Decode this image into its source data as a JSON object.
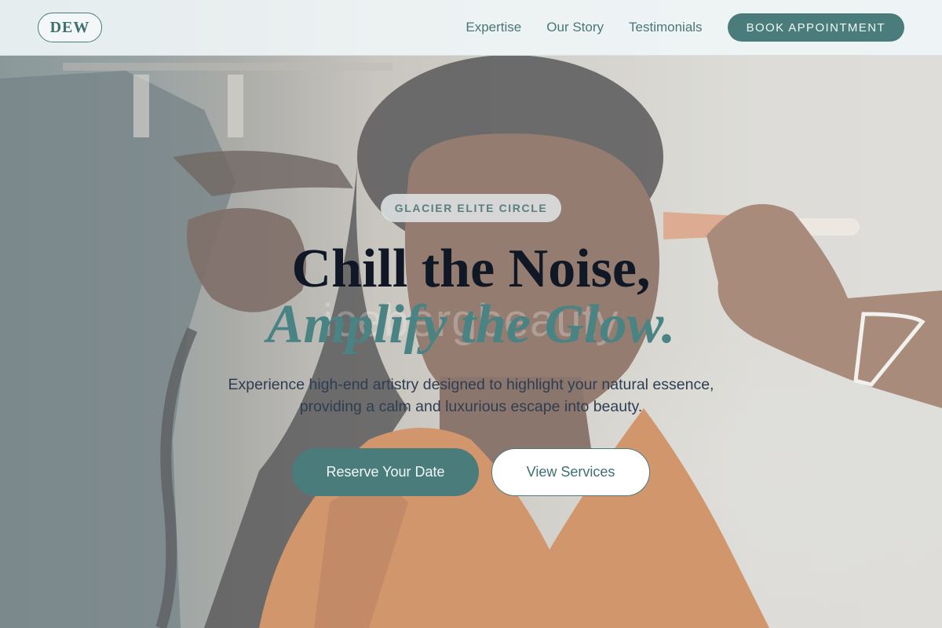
{
  "brand": {
    "logo_text": "DEW"
  },
  "nav": {
    "links": [
      "Expertise",
      "Our Story",
      "Testimonials"
    ],
    "cta_label": "BOOK APPOINTMENT"
  },
  "hero": {
    "badge": "GLACIER ELITE CIRCLE",
    "title_line1": "Chill the Noise,",
    "title_line2": "Amplify the Glow.",
    "watermark": "icebergbeauty",
    "subtitle": "Experience high-end artistry designed to highlight your natural essence, providing a calm and luxurious escape into beauty.",
    "primary_button": "Reserve Your Date",
    "secondary_button": "View Services",
    "background_image": "salon-makeup-portrait"
  },
  "colors": {
    "accent": "#4b7c7c",
    "title_dark": "#101826",
    "title_accent": "#4a8383",
    "body_text": "#2f3d52"
  }
}
